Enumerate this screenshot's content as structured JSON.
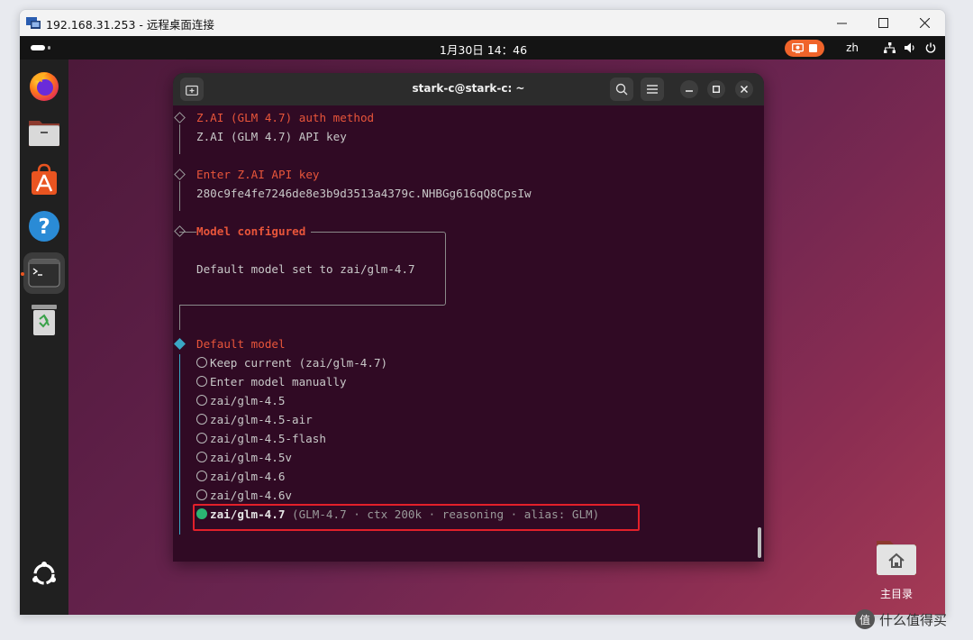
{
  "rdp": {
    "title": "192.168.31.253 - 远程桌面连接",
    "controls": {
      "minimize": "—",
      "maximize": "☐",
      "close": "✕"
    }
  },
  "gnome": {
    "clock": "1月30日  14：46",
    "input_method": "zh",
    "icons": [
      "screen-record-icon",
      "stop-icon",
      "network-icon",
      "volume-icon",
      "power-icon"
    ]
  },
  "dock": {
    "items": [
      "firefox",
      "files",
      "app-center",
      "help",
      "terminal",
      "trash",
      "show-apps"
    ]
  },
  "desktop": {
    "home_label": "主目录"
  },
  "terminal": {
    "title": "stark-c@stark-c: ~",
    "auth_method_label": "Z.AI (GLM 4.7) auth method",
    "auth_method_value": "Z.AI (GLM 4.7) API key",
    "api_key_label": "Enter Z.AI API key",
    "api_key_value": "280c9fe4fe7246de8e3b9d3513a4379c.NHBGg616qQ8CpsIw",
    "model_configured_label": "Model configured",
    "model_configured_text": "Default model set to zai/glm-4.7",
    "default_model_label": "Default model",
    "options": [
      "Keep current (zai/glm-4.7)",
      "Enter model manually",
      "zai/glm-4.5",
      "zai/glm-4.5-air",
      "zai/glm-4.5-flash",
      "zai/glm-4.5v",
      "zai/glm-4.6",
      "zai/glm-4.6v"
    ],
    "selected_option": "zai/glm-4.7",
    "selected_option_hint": "(GLM-4.7 · ctx 200k · reasoning · alias: GLM)"
  },
  "watermark": {
    "badge": "值",
    "text": "什么值得买"
  },
  "colors": {
    "terminal_bg": "#300a24",
    "prompt_accent": "#e8553a",
    "selected_radio": "#2bb673",
    "highlight_box": "#e3202a",
    "ubuntu_orange": "#e95420"
  }
}
